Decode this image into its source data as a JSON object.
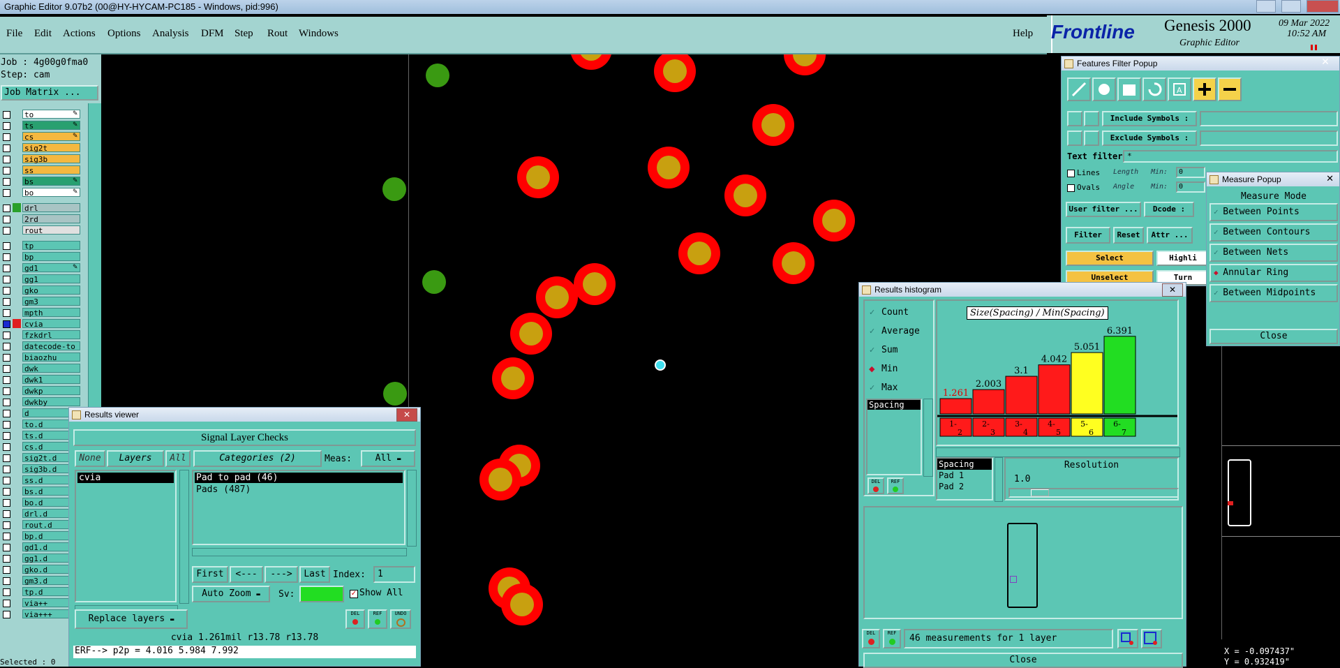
{
  "window": {
    "title": "Graphic Editor 9.07b2 (00@HY-HYCAM-PC185 - Windows, pid:996)"
  },
  "menubar": {
    "items": [
      "File",
      "Edit",
      "Actions",
      "Options",
      "Analysis",
      "DFM",
      "Step",
      "Rout",
      "Windows"
    ],
    "help": "Help"
  },
  "brand": {
    "logo": "Frontline",
    "product": "Genesis 2000",
    "subtitle": "Graphic Editor",
    "date": "09 Mar 2022",
    "time": "10:52 AM"
  },
  "left": {
    "job": "Job : 4g00g0fma0",
    "step": "Step: cam",
    "job_matrix": "Job Matrix ...",
    "layers": [
      {
        "name": "to",
        "color": "#ffffff",
        "mark": true
      },
      {
        "name": "ts",
        "color": "#28a070",
        "mark": true
      },
      {
        "name": "cs",
        "color": "#f4b840",
        "mark": true
      },
      {
        "name": "sig2t",
        "color": "#f4b840",
        "mark": false
      },
      {
        "name": "sig3b",
        "color": "#f4b840",
        "mark": false
      },
      {
        "name": "ss",
        "color": "#f4b840",
        "mark": false
      },
      {
        "name": "bs",
        "color": "#28a070",
        "mark": true
      },
      {
        "name": "bo",
        "color": "#ffffff",
        "mark": true
      },
      {
        "name": "drl",
        "color": "#a8c4c4",
        "mark": false,
        "swatch": "#2aa02a"
      },
      {
        "name": "2rd",
        "color": "#a8c4c4",
        "mark": false
      },
      {
        "name": "rout",
        "color": "#e0e0e0",
        "mark": false
      },
      {
        "name": "tp",
        "color": "#5cc6b4",
        "mark": false
      },
      {
        "name": "bp",
        "color": "#5cc6b4",
        "mark": false
      },
      {
        "name": "gd1",
        "color": "#5cc6b4",
        "mark": true
      },
      {
        "name": "gg1",
        "color": "#5cc6b4",
        "mark": false
      },
      {
        "name": "gko",
        "color": "#5cc6b4",
        "mark": false
      },
      {
        "name": "gm3",
        "color": "#5cc6b4",
        "mark": false
      },
      {
        "name": "mpth",
        "color": "#5cc6b4",
        "mark": false
      },
      {
        "name": "cvia",
        "color": "#5cc6b4",
        "mark": false,
        "swatch": "#e02020",
        "active": true
      },
      {
        "name": "fzkdrl",
        "color": "#5cc6b4",
        "mark": false
      },
      {
        "name": "datecode-to",
        "color": "#5cc6b4",
        "mark": false
      },
      {
        "name": "biaozhu",
        "color": "#5cc6b4",
        "mark": false
      },
      {
        "name": "dwk",
        "color": "#5cc6b4",
        "mark": false
      },
      {
        "name": "dwk1",
        "color": "#5cc6b4",
        "mark": false
      },
      {
        "name": "dwkp",
        "color": "#5cc6b4",
        "mark": false
      },
      {
        "name": "dwkby",
        "color": "#5cc6b4",
        "mark": false
      },
      {
        "name": "d",
        "color": "#5cc6b4",
        "mark": false
      },
      {
        "name": "to.d",
        "color": "#5cc6b4",
        "mark": false
      },
      {
        "name": "ts.d",
        "color": "#5cc6b4",
        "mark": false
      },
      {
        "name": "cs.d",
        "color": "#5cc6b4",
        "mark": false
      },
      {
        "name": "sig2t.d",
        "color": "#5cc6b4",
        "mark": false
      },
      {
        "name": "sig3b.d",
        "color": "#5cc6b4",
        "mark": false
      },
      {
        "name": "ss.d",
        "color": "#5cc6b4",
        "mark": false
      },
      {
        "name": "bs.d",
        "color": "#5cc6b4",
        "mark": false
      },
      {
        "name": "bo.d",
        "color": "#5cc6b4",
        "mark": false
      },
      {
        "name": "drl.d",
        "color": "#5cc6b4",
        "mark": false
      },
      {
        "name": "rout.d",
        "color": "#5cc6b4",
        "mark": false
      },
      {
        "name": "bp.d",
        "color": "#5cc6b4",
        "mark": false
      },
      {
        "name": "gd1.d",
        "color": "#5cc6b4",
        "mark": false
      },
      {
        "name": "gg1.d",
        "color": "#5cc6b4",
        "mark": false
      },
      {
        "name": "gko.d",
        "color": "#5cc6b4",
        "mark": false
      },
      {
        "name": "gm3.d",
        "color": "#5cc6b4",
        "mark": false
      },
      {
        "name": "tp.d",
        "color": "#5cc6b4",
        "mark": false
      },
      {
        "name": "via++",
        "color": "#5cc6b4",
        "mark": false
      },
      {
        "name": "via+++",
        "color": "#5cc6b4",
        "mark": false
      }
    ],
    "selected": "Selected : 0"
  },
  "results_viewer": {
    "title": "Results viewer",
    "header": "Signal Layer Checks",
    "none": "None",
    "layers": "Layers",
    "all": "All",
    "categories": "Categories (2)",
    "meas_label": "Meas:",
    "meas_value": "All",
    "layer_list": [
      "cvia"
    ],
    "category_list": [
      "Pad to pad (46)",
      "Pads (487)"
    ],
    "first": "First",
    "prev": "<---",
    "next": "--->",
    "last": "Last",
    "index_label": "Index:",
    "index_value": "1",
    "auto_zoom": "Auto Zoom",
    "sv_label": "Sv:",
    "show_all": "Show All",
    "replace_layers": "Replace layers",
    "del": "DEL",
    "ref": "REF",
    "undo": "UNDO",
    "status": "cvia 1.261mil  r13.78  r13.78",
    "erf": "ERF--> p2p = 4.016 5.984 7.992"
  },
  "histogram": {
    "title": "Results histogram",
    "options": [
      "Count",
      "Average",
      "Sum",
      "Min",
      "Max"
    ],
    "selected_option": "Min",
    "list": [
      "Spacing"
    ],
    "chart_title": "Size(Spacing) / Min(Spacing)",
    "del": "DEL",
    "ref": "REF",
    "sublist": [
      "Spacing",
      "Pad 1",
      "Pad 2"
    ],
    "resolution_label": "Resolution",
    "resolution_value": "1.0",
    "summary": "46 measurements for 1 layer",
    "close": "Close"
  },
  "chart_data": {
    "type": "bar",
    "title": "Size(Spacing) / Min(Spacing)",
    "categories": [
      "1-2",
      "2-3",
      "3-4",
      "4-5",
      "5-6",
      "6-7"
    ],
    "values": [
      1.261,
      2.003,
      3.1,
      4.042,
      5.051,
      6.391
    ],
    "value_labels": [
      "1.261",
      "2.003",
      "3.1",
      "4.042",
      "5.051",
      "6.391"
    ],
    "colors": [
      "#ff1a1a",
      "#ff1a1a",
      "#ff1a1a",
      "#ff1a1a",
      "#ffff20",
      "#22dd22"
    ],
    "ylim": [
      0,
      7
    ],
    "legend": "none",
    "grid": false
  },
  "measure": {
    "title": "Measure Popup",
    "mode_label": "Measure Mode",
    "modes": [
      "Between Points",
      "Between Contours",
      "Between Nets",
      "Annular Ring",
      "Between Midpoints"
    ],
    "selected_mode": "Annular Ring",
    "close": "Close",
    "x": "X = -0.097437\"",
    "y": "Y = 0.932419\""
  },
  "features_filter": {
    "title": "Features Filter Popup",
    "include": "Include Symbols :",
    "exclude": "Exclude Symbols :",
    "text_filter": "Text filter",
    "text_value": "*",
    "lines": "Lines",
    "ovals": "Ovals",
    "length": "Length",
    "angle": "Angle",
    "min": "Min:",
    "min_value": "0",
    "user_filter": "User filter ...",
    "dcode": "Dcode :",
    "filter": "Filter",
    "reset": "Reset",
    "attr": "Attr ...",
    "select": "Select",
    "unselect": "Unselect",
    "highlight": "Highli",
    "turn": "Turn"
  }
}
